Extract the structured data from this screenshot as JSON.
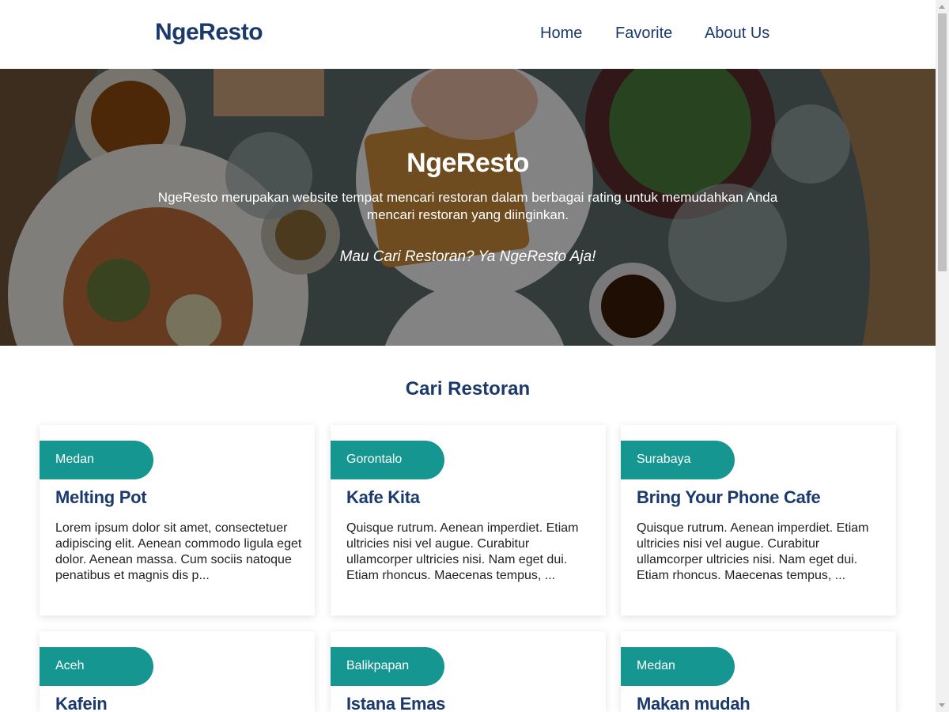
{
  "header": {
    "brand": "NgeResto",
    "nav": [
      {
        "label": "Home"
      },
      {
        "label": "Favorite"
      },
      {
        "label": "About Us"
      }
    ]
  },
  "hero": {
    "title": "NgeResto",
    "description": "NgeResto merupakan website tempat mencari restoran dalam berbagai rating untuk memudahkan Anda mencari restoran yang diinginkan.",
    "tagline": "Mau Cari Restoran? Ya NgeResto Aja!"
  },
  "section": {
    "title": "Cari Restoran"
  },
  "restaurants": [
    {
      "city": "Medan",
      "name": "Melting Pot",
      "description": "Lorem ipsum dolor sit amet, consectetuer adipiscing elit. Aenean commodo ligula eget dolor. Aenean massa. Cum sociis natoque penatibus et magnis dis p..."
    },
    {
      "city": "Gorontalo",
      "name": "Kafe Kita",
      "description": "Quisque rutrum. Aenean imperdiet. Etiam ultricies nisi vel augue. Curabitur ullamcorper ultricies nisi. Nam eget dui. Etiam rhoncus. Maecenas tempus, ..."
    },
    {
      "city": "Surabaya",
      "name": "Bring Your Phone Cafe",
      "description": "Quisque rutrum. Aenean imperdiet. Etiam ultricies nisi vel augue. Curabitur ullamcorper ultricies nisi. Nam eget dui. Etiam rhoncus. Maecenas tempus, ..."
    },
    {
      "city": "Aceh",
      "name": "Kafein",
      "description": ""
    },
    {
      "city": "Balikpapan",
      "name": "Istana Emas",
      "description": ""
    },
    {
      "city": "Medan",
      "name": "Makan mudah",
      "description": ""
    }
  ],
  "colors": {
    "brand": "#1b3a6b",
    "accent": "#169691"
  }
}
